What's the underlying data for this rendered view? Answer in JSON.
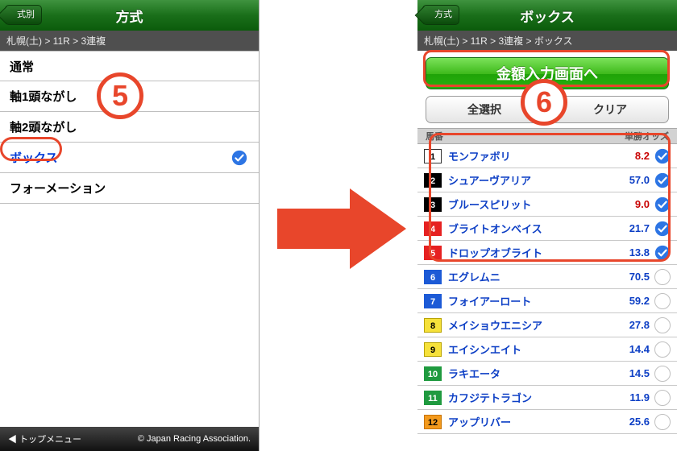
{
  "left": {
    "back_label": "式別",
    "title": "方式",
    "breadcrumb": "札幌(土) > 11R > 3連複",
    "menu": [
      {
        "label": "通常",
        "selected": false
      },
      {
        "label": "軸1頭ながし",
        "selected": false
      },
      {
        "label": "軸2頭ながし",
        "selected": false
      },
      {
        "label": "ボックス",
        "selected": true
      },
      {
        "label": "フォーメーション",
        "selected": false
      }
    ],
    "footer_left": "◀ トップメニュー",
    "footer_right": "© Japan Racing Association."
  },
  "right": {
    "back_label": "方式",
    "title": "ボックス",
    "breadcrumb": "札幌(土) > 11R > 3連複 > ボックス",
    "primary_btn": "金額入力画面へ",
    "select_all": "全選択",
    "clear": "クリア",
    "col_num": "馬番",
    "col_name": "",
    "col_odds": "単勝オッズ",
    "horses": [
      {
        "num": "1",
        "frame": "f-white",
        "name": "モンファボリ",
        "odds": "8.2",
        "odds_color": "#c90404",
        "selected": true
      },
      {
        "num": "2",
        "frame": "f-black",
        "name": "シュアーヴアリア",
        "odds": "57.0",
        "odds_color": "#0d3fc5",
        "selected": true
      },
      {
        "num": "3",
        "frame": "f-black",
        "name": "ブルースピリット",
        "odds": "9.0",
        "odds_color": "#c90404",
        "selected": true
      },
      {
        "num": "4",
        "frame": "f-red",
        "name": "ブライトオンベイス",
        "odds": "21.7",
        "odds_color": "#0d3fc5",
        "selected": true
      },
      {
        "num": "5",
        "frame": "f-red",
        "name": "ドロップオブライト",
        "odds": "13.8",
        "odds_color": "#0d3fc5",
        "selected": true
      },
      {
        "num": "6",
        "frame": "f-blue",
        "name": "エグレムニ",
        "odds": "70.5",
        "odds_color": "#0d3fc5",
        "selected": false
      },
      {
        "num": "7",
        "frame": "f-blue",
        "name": "フォイアーロート",
        "odds": "59.2",
        "odds_color": "#0d3fc5",
        "selected": false
      },
      {
        "num": "8",
        "frame": "f-yellow",
        "name": "メイショウエニシア",
        "odds": "27.8",
        "odds_color": "#0d3fc5",
        "selected": false
      },
      {
        "num": "9",
        "frame": "f-yellow",
        "name": "エイシンエイト",
        "odds": "14.4",
        "odds_color": "#0d3fc5",
        "selected": false
      },
      {
        "num": "10",
        "frame": "f-green",
        "name": "ラキエータ",
        "odds": "14.5",
        "odds_color": "#0d3fc5",
        "selected": false
      },
      {
        "num": "11",
        "frame": "f-green",
        "name": "カフジテトラゴン",
        "odds": "11.9",
        "odds_color": "#0d3fc5",
        "selected": false
      },
      {
        "num": "12",
        "frame": "f-orange",
        "name": "アップリバー",
        "odds": "25.6",
        "odds_color": "#0d3fc5",
        "selected": false
      }
    ]
  },
  "callouts": {
    "five": "5",
    "six": "6"
  }
}
